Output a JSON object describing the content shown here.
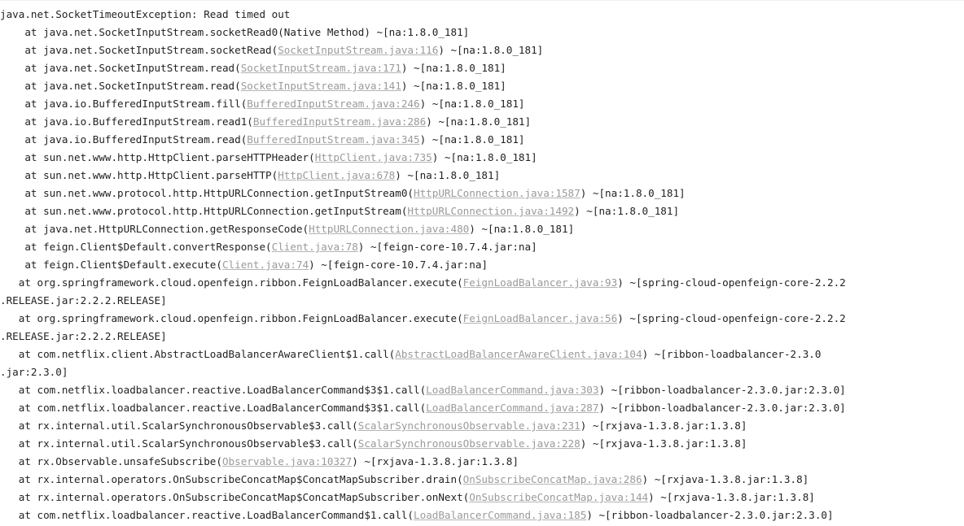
{
  "console": {
    "title": "java.net.SocketTimeoutException stack trace",
    "background_color": "#ffffff",
    "text_color": "#222222",
    "link_color": "#9a9a9a",
    "font_size_px": 12.6,
    "line_height_px": 22
  },
  "stacktrace": {
    "exception_header": "java.net.SocketTimeoutException: Read timed out",
    "lines": [
      {
        "type": "exception",
        "segments": [
          {
            "kind": "plain",
            "text": "java.net.SocketTimeoutException: Read timed out"
          }
        ]
      },
      {
        "type": "frame",
        "segments": [
          {
            "kind": "plain",
            "text": "    at java.net.SocketInputStream.socketRead0(Native Method) ~[na:1.8.0_181]"
          }
        ]
      },
      {
        "type": "frame",
        "segments": [
          {
            "kind": "plain",
            "text": "    at java.net.SocketInputStream.socketRead("
          },
          {
            "kind": "link",
            "text": "SocketInputStream.java:116"
          },
          {
            "kind": "plain",
            "text": ") ~[na:1.8.0_181]"
          }
        ]
      },
      {
        "type": "frame",
        "segments": [
          {
            "kind": "plain",
            "text": "    at java.net.SocketInputStream.read("
          },
          {
            "kind": "link",
            "text": "SocketInputStream.java:171"
          },
          {
            "kind": "plain",
            "text": ") ~[na:1.8.0_181]"
          }
        ]
      },
      {
        "type": "frame",
        "segments": [
          {
            "kind": "plain",
            "text": "    at java.net.SocketInputStream.read("
          },
          {
            "kind": "link",
            "text": "SocketInputStream.java:141"
          },
          {
            "kind": "plain",
            "text": ") ~[na:1.8.0_181]"
          }
        ]
      },
      {
        "type": "frame",
        "segments": [
          {
            "kind": "plain",
            "text": "    at java.io.BufferedInputStream.fill("
          },
          {
            "kind": "link",
            "text": "BufferedInputStream.java:246"
          },
          {
            "kind": "plain",
            "text": ") ~[na:1.8.0_181]"
          }
        ]
      },
      {
        "type": "frame",
        "segments": [
          {
            "kind": "plain",
            "text": "    at java.io.BufferedInputStream.read1("
          },
          {
            "kind": "link",
            "text": "BufferedInputStream.java:286"
          },
          {
            "kind": "plain",
            "text": ") ~[na:1.8.0_181]"
          }
        ]
      },
      {
        "type": "frame",
        "segments": [
          {
            "kind": "plain",
            "text": "    at java.io.BufferedInputStream.read("
          },
          {
            "kind": "link",
            "text": "BufferedInputStream.java:345"
          },
          {
            "kind": "plain",
            "text": ") ~[na:1.8.0_181]"
          }
        ]
      },
      {
        "type": "frame",
        "segments": [
          {
            "kind": "plain",
            "text": "    at sun.net.www.http.HttpClient.parseHTTPHeader("
          },
          {
            "kind": "link",
            "text": "HttpClient.java:735"
          },
          {
            "kind": "plain",
            "text": ") ~[na:1.8.0_181]"
          }
        ]
      },
      {
        "type": "frame",
        "segments": [
          {
            "kind": "plain",
            "text": "    at sun.net.www.http.HttpClient.parseHTTP("
          },
          {
            "kind": "link",
            "text": "HttpClient.java:678"
          },
          {
            "kind": "plain",
            "text": ") ~[na:1.8.0_181]"
          }
        ]
      },
      {
        "type": "frame",
        "segments": [
          {
            "kind": "plain",
            "text": "    at sun.net.www.protocol.http.HttpURLConnection.getInputStream0("
          },
          {
            "kind": "link",
            "text": "HttpURLConnection.java:1587"
          },
          {
            "kind": "plain",
            "text": ") ~[na:1.8.0_181]"
          }
        ]
      },
      {
        "type": "frame",
        "segments": [
          {
            "kind": "plain",
            "text": "    at sun.net.www.protocol.http.HttpURLConnection.getInputStream("
          },
          {
            "kind": "link",
            "text": "HttpURLConnection.java:1492"
          },
          {
            "kind": "plain",
            "text": ") ~[na:1.8.0_181]"
          }
        ]
      },
      {
        "type": "frame",
        "segments": [
          {
            "kind": "plain",
            "text": "    at java.net.HttpURLConnection.getResponseCode("
          },
          {
            "kind": "link",
            "text": "HttpURLConnection.java:480"
          },
          {
            "kind": "plain",
            "text": ") ~[na:1.8.0_181]"
          }
        ]
      },
      {
        "type": "frame",
        "segments": [
          {
            "kind": "plain",
            "text": "    at feign.Client$Default.convertResponse("
          },
          {
            "kind": "link",
            "text": "Client.java:78"
          },
          {
            "kind": "plain",
            "text": ") ~[feign-core-10.7.4.jar:na]"
          }
        ]
      },
      {
        "type": "frame",
        "segments": [
          {
            "kind": "plain",
            "text": "    at feign.Client$Default.execute("
          },
          {
            "kind": "link",
            "text": "Client.java:74"
          },
          {
            "kind": "plain",
            "text": ") ~[feign-core-10.7.4.jar:na]"
          }
        ]
      },
      {
        "type": "frame",
        "segments": [
          {
            "kind": "plain",
            "text": "   at org.springframework.cloud.openfeign.ribbon.FeignLoadBalancer.execute("
          },
          {
            "kind": "link",
            "text": "FeignLoadBalancer.java:93"
          },
          {
            "kind": "plain",
            "text": ") ~[spring-cloud-openfeign-core-2.2.2"
          }
        ]
      },
      {
        "type": "wrap",
        "segments": [
          {
            "kind": "plain",
            "text": ".RELEASE.jar:2.2.2.RELEASE]"
          }
        ]
      },
      {
        "type": "frame",
        "segments": [
          {
            "kind": "plain",
            "text": "   at org.springframework.cloud.openfeign.ribbon.FeignLoadBalancer.execute("
          },
          {
            "kind": "link",
            "text": "FeignLoadBalancer.java:56"
          },
          {
            "kind": "plain",
            "text": ") ~[spring-cloud-openfeign-core-2.2.2"
          }
        ]
      },
      {
        "type": "wrap",
        "segments": [
          {
            "kind": "plain",
            "text": ".RELEASE.jar:2.2.2.RELEASE]"
          }
        ]
      },
      {
        "type": "frame",
        "segments": [
          {
            "kind": "plain",
            "text": "   at com.netflix.client.AbstractLoadBalancerAwareClient$1.call("
          },
          {
            "kind": "link",
            "text": "AbstractLoadBalancerAwareClient.java:104"
          },
          {
            "kind": "plain",
            "text": ") ~[ribbon-loadbalancer-2.3.0"
          }
        ]
      },
      {
        "type": "wrap",
        "segments": [
          {
            "kind": "plain",
            "text": ".jar:2.3.0]"
          }
        ]
      },
      {
        "type": "frame",
        "segments": [
          {
            "kind": "plain",
            "text": "   at com.netflix.loadbalancer.reactive.LoadBalancerCommand$3$1.call("
          },
          {
            "kind": "link",
            "text": "LoadBalancerCommand.java:303"
          },
          {
            "kind": "plain",
            "text": ") ~[ribbon-loadbalancer-2.3.0.jar:2.3.0]"
          }
        ]
      },
      {
        "type": "frame",
        "segments": [
          {
            "kind": "plain",
            "text": "   at com.netflix.loadbalancer.reactive.LoadBalancerCommand$3$1.call("
          },
          {
            "kind": "link",
            "text": "LoadBalancerCommand.java:287"
          },
          {
            "kind": "plain",
            "text": ") ~[ribbon-loadbalancer-2.3.0.jar:2.3.0]"
          }
        ]
      },
      {
        "type": "frame",
        "segments": [
          {
            "kind": "plain",
            "text": "   at rx.internal.util.ScalarSynchronousObservable$3.call("
          },
          {
            "kind": "link",
            "text": "ScalarSynchronousObservable.java:231"
          },
          {
            "kind": "plain",
            "text": ") ~[rxjava-1.3.8.jar:1.3.8]"
          }
        ]
      },
      {
        "type": "frame",
        "segments": [
          {
            "kind": "plain",
            "text": "   at rx.internal.util.ScalarSynchronousObservable$3.call("
          },
          {
            "kind": "link",
            "text": "ScalarSynchronousObservable.java:228"
          },
          {
            "kind": "plain",
            "text": ") ~[rxjava-1.3.8.jar:1.3.8]"
          }
        ]
      },
      {
        "type": "frame",
        "segments": [
          {
            "kind": "plain",
            "text": "   at rx.Observable.unsafeSubscribe("
          },
          {
            "kind": "link",
            "text": "Observable.java:10327"
          },
          {
            "kind": "plain",
            "text": ") ~[rxjava-1.3.8.jar:1.3.8]"
          }
        ]
      },
      {
        "type": "frame",
        "segments": [
          {
            "kind": "plain",
            "text": "   at rx.internal.operators.OnSubscribeConcatMap$ConcatMapSubscriber.drain("
          },
          {
            "kind": "link",
            "text": "OnSubscribeConcatMap.java:286"
          },
          {
            "kind": "plain",
            "text": ") ~[rxjava-1.3.8.jar:1.3.8]"
          }
        ]
      },
      {
        "type": "frame",
        "segments": [
          {
            "kind": "plain",
            "text": "   at rx.internal.operators.OnSubscribeConcatMap$ConcatMapSubscriber.onNext("
          },
          {
            "kind": "link",
            "text": "OnSubscribeConcatMap.java:144"
          },
          {
            "kind": "plain",
            "text": ") ~[rxjava-1.3.8.jar:1.3.8]"
          }
        ]
      },
      {
        "type": "frame",
        "segments": [
          {
            "kind": "plain",
            "text": "   at com.netflix.loadbalancer.reactive.LoadBalancerCommand$1.call("
          },
          {
            "kind": "link",
            "text": "LoadBalancerCommand.java:185"
          },
          {
            "kind": "plain",
            "text": ") ~[ribbon-loadbalancer-2.3.0.jar:2.3.0]"
          }
        ]
      }
    ]
  }
}
